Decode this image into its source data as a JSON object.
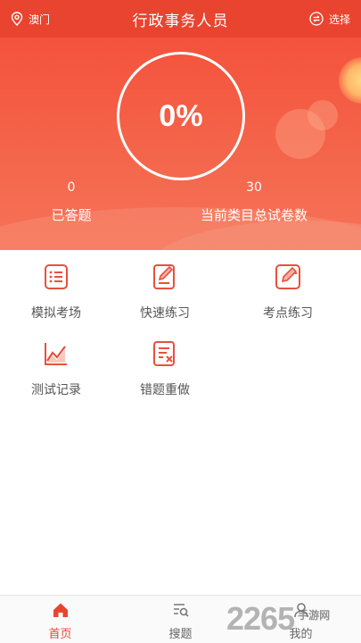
{
  "header": {
    "location": "澳门",
    "title": "行政事务人员",
    "select_label": "选择"
  },
  "progress": {
    "percent_text": "0%",
    "answered_count": "0",
    "answered_label": "已答题",
    "total_count": "30",
    "total_label": "当前类目总试卷数"
  },
  "menu": [
    {
      "label": "模拟考场",
      "icon": "list-doc-icon"
    },
    {
      "label": "快速练习",
      "icon": "edit-doc-icon"
    },
    {
      "label": "考点练习",
      "icon": "pencil-note-icon"
    },
    {
      "label": "测试记录",
      "icon": "chart-line-icon"
    },
    {
      "label": "错题重做",
      "icon": "wrong-doc-icon"
    }
  ],
  "bottom_nav": [
    {
      "label": "首页",
      "icon": "home-icon",
      "active": true
    },
    {
      "label": "搜题",
      "icon": "search-list-icon",
      "active": false
    },
    {
      "label": "我的",
      "icon": "user-icon",
      "active": false
    }
  ],
  "watermark": {
    "big": "2265",
    "small": "手游网"
  },
  "colors": {
    "primary": "#e84430",
    "icon": "#e8503c"
  }
}
